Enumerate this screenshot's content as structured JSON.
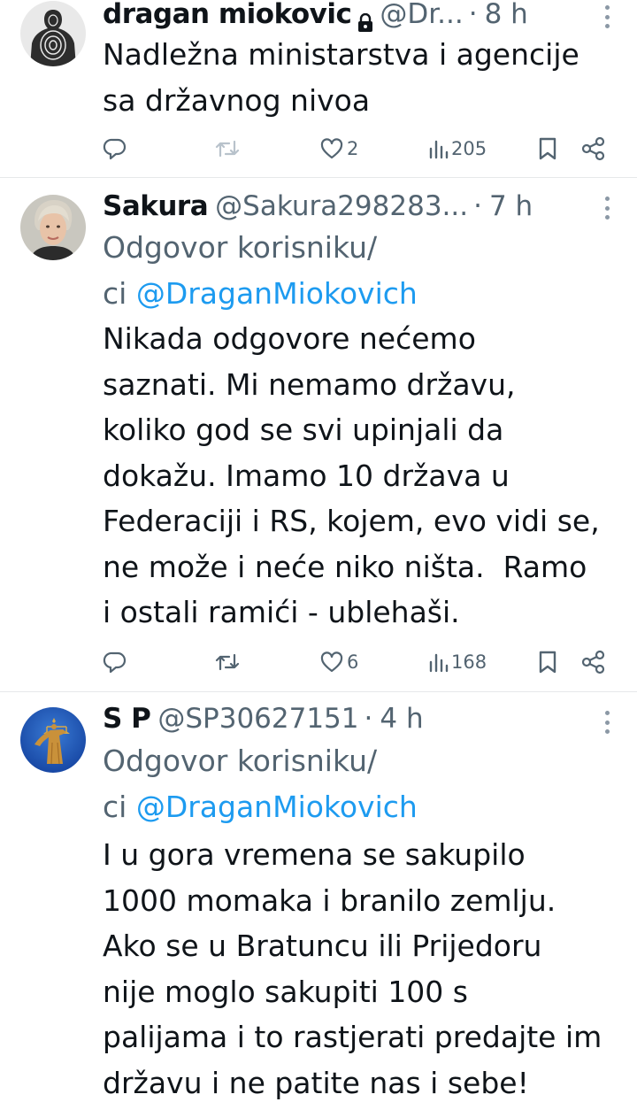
{
  "tweets": [
    {
      "name": "dragan miokovic",
      "handle": "@Dr...",
      "time": "8 h",
      "reply_prefix": "",
      "reply_mention": "",
      "text": "Nadležna ministarstva i agencije\nsa državnog nivoa",
      "likes": "2",
      "views": "205",
      "avatar_icon": "target-silhouette-avatar",
      "locked": true
    },
    {
      "name": "Sakura",
      "handle": "@Sakura298283...",
      "time": "7 h",
      "reply_prefix": "Odgovor korisniku/\nci ",
      "reply_mention": "@DraganMiokovich",
      "text": "Nikada odgovore nećemo\nsaznati. Mi nemamo državu,\nkoliko god se svi upinjali da\ndokažu. Imamo 10 država u\nFederaciji i RS, kojem, evo vidi se,\nne može i neće niko ništa.  Ramo\ni ostali ramići - ublehaši.",
      "likes": "6",
      "views": "168",
      "avatar_icon": "woman-portrait-avatar",
      "locked": false
    },
    {
      "name": "S P",
      "handle": "@SP30627151",
      "time": "4 h",
      "reply_prefix": "Odgovor korisniku/\nci ",
      "reply_mention": "@DraganMiokovich",
      "text": "I u gora vremena se sakupilo\n1000 momaka i branilo zemlju.\nAko se u Bratuncu ili Prijedoru\nnije moglo sakupiti 100 s\npalijama i to rastjerati predajte im\ndržavu i ne patite nas i sebe!",
      "likes": "",
      "views": "",
      "avatar_icon": "lady-justice-statue-avatar",
      "locked": false
    }
  ],
  "colors": {
    "text": "#0f1419",
    "secondary": "#536471",
    "link": "#1d9bf0",
    "divider": "#e6e8ea"
  }
}
